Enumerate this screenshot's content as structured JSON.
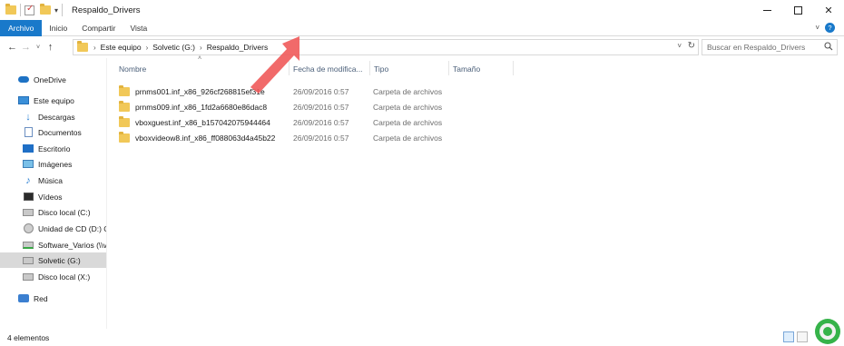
{
  "window": {
    "title": "Respaldo_Drivers",
    "qat_dropdown": "▾",
    "controls": {
      "minimize": "",
      "maximize": "",
      "close": "✕"
    }
  },
  "ribbon": {
    "tabs": [
      {
        "label": "Archivo"
      },
      {
        "label": "Inicio"
      },
      {
        "label": "Compartir"
      },
      {
        "label": "Vista"
      }
    ],
    "expand": "˅",
    "help": "?"
  },
  "address": {
    "back": "←",
    "forward": "→",
    "recent": "˅",
    "up": "↑",
    "crumbs": [
      "Este equipo",
      "Solvetic (G:)",
      "Respaldo_Drivers"
    ],
    "crumb_separator": "›",
    "dropdown": "˅",
    "refresh": "↻"
  },
  "search": {
    "placeholder": "Buscar en Respaldo_Drivers",
    "icon": "⌕"
  },
  "sidebar": {
    "items": [
      {
        "label": "OneDrive",
        "icon": "onedrive-icon",
        "selected": false
      },
      {
        "label": "Este equipo",
        "icon": "pc-icon",
        "selected": false
      },
      {
        "label": "Descargas",
        "icon": "downloads-icon",
        "selected": false
      },
      {
        "label": "Documentos",
        "icon": "documents-icon",
        "selected": false
      },
      {
        "label": "Escritorio",
        "icon": "desktop-icon",
        "selected": false
      },
      {
        "label": "Imágenes",
        "icon": "pictures-icon",
        "selected": false
      },
      {
        "label": "Música",
        "icon": "music-icon",
        "selected": false
      },
      {
        "label": "Vídeos",
        "icon": "videos-icon",
        "selected": false
      },
      {
        "label": "Disco local (C:)",
        "icon": "drive-icon",
        "selected": false
      },
      {
        "label": "Unidad de CD (D:) C",
        "icon": "cd-drive-icon",
        "selected": false
      },
      {
        "label": "Software_Varios (\\\\v",
        "icon": "network-drive-icon",
        "selected": false
      },
      {
        "label": "Solvetic (G:)",
        "icon": "drive-icon",
        "selected": true
      },
      {
        "label": "Disco local (X:)",
        "icon": "drive-icon",
        "selected": false
      },
      {
        "label": "Red",
        "icon": "network-icon",
        "selected": false
      }
    ]
  },
  "columns": {
    "name": "Nombre",
    "date": "Fecha de modifica...",
    "type": "Tipo",
    "size": "Tamaño",
    "sort_indicator": "˄"
  },
  "files": [
    {
      "name": "prnms001.inf_x86_926cf268815ef31e",
      "date": "26/09/2016 0:57",
      "type": "Carpeta de archivos"
    },
    {
      "name": "prnms009.inf_x86_1fd2a6680e86dac8",
      "date": "26/09/2016 0:57",
      "type": "Carpeta de archivos"
    },
    {
      "name": "vboxguest.inf_x86_b15704207594446​4",
      "date": "26/09/2016 0:57",
      "type": "Carpeta de archivos"
    },
    {
      "name": "vboxvideow8.inf_x86_ff088063d4a45b22",
      "date": "26/09/2016 0:57",
      "type": "Carpeta de archivos"
    }
  ],
  "status": {
    "count": "4 elementos"
  },
  "colors": {
    "file_tab": "#1979ca",
    "folder": "#f1c858",
    "arrow": "#f05a5a",
    "selected_nav": "#d9d9d9",
    "watermark": "#36b34a"
  }
}
